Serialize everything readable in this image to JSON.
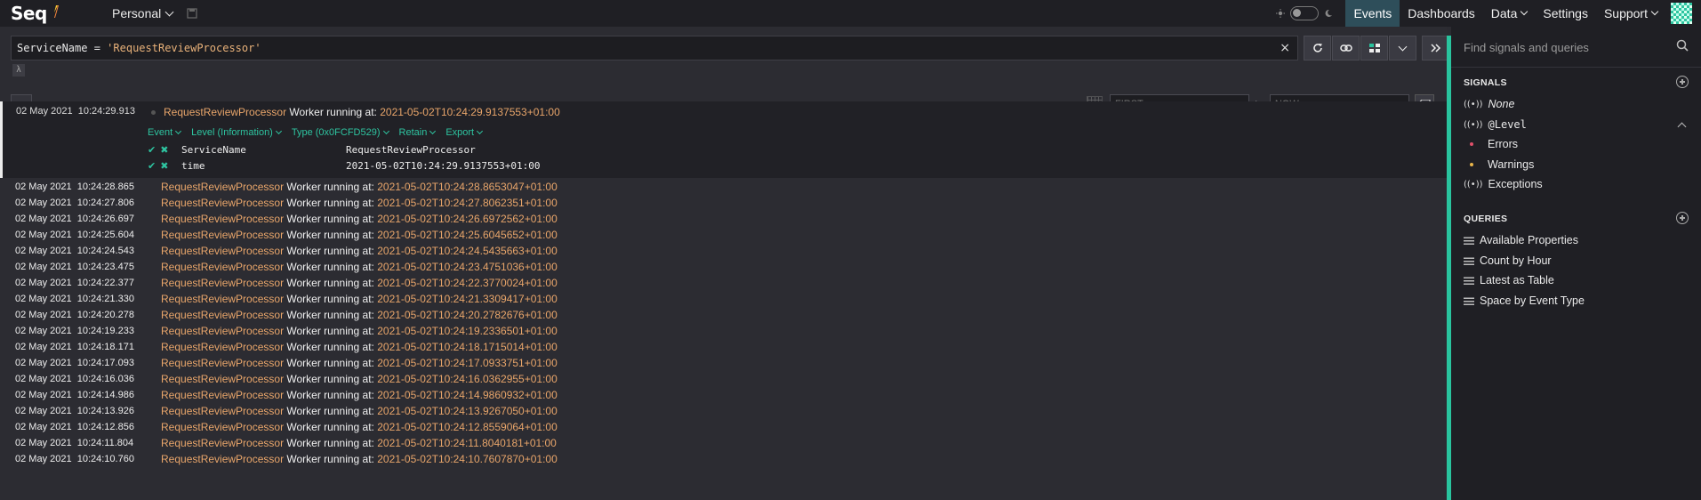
{
  "app": {
    "logo": "Seq",
    "workspace": "Personal"
  },
  "nav": {
    "items": [
      {
        "label": "Events",
        "active": true,
        "dropdown": false
      },
      {
        "label": "Dashboards",
        "active": false,
        "dropdown": false
      },
      {
        "label": "Data",
        "active": false,
        "dropdown": true
      },
      {
        "label": "Settings",
        "active": false,
        "dropdown": false
      },
      {
        "label": "Support",
        "active": false,
        "dropdown": true
      }
    ]
  },
  "query": {
    "field": "ServiceName",
    "op": " = ",
    "value": "'RequestReviewProcessor'",
    "lambda": "λ"
  },
  "range": {
    "from_placeholder": "FIRST",
    "to_label": "to",
    "to_placeholder": "NOW"
  },
  "expanded_event": {
    "timestamp": "02 May 2021  10:24:29.913",
    "service": "RequestReviewProcessor",
    "text": " Worker running at: ",
    "value": "2021-05-02T10:24:29.9137553+01:00",
    "actions": [
      "Event",
      "Level (Information)",
      "Type (0x0FCFD529)",
      "Retain",
      "Export"
    ],
    "properties": [
      {
        "name": "ServiceName",
        "value": "RequestReviewProcessor"
      },
      {
        "name": "time",
        "value": "2021-05-02T10:24:29.9137553+01:00"
      }
    ]
  },
  "events": [
    {
      "timestamp": "02 May 2021  10:24:28.865",
      "service": "RequestReviewProcessor",
      "text": " Worker running at: ",
      "value": "2021-05-02T10:24:28.8653047+01:00"
    },
    {
      "timestamp": "02 May 2021  10:24:27.806",
      "service": "RequestReviewProcessor",
      "text": " Worker running at: ",
      "value": "2021-05-02T10:24:27.8062351+01:00"
    },
    {
      "timestamp": "02 May 2021  10:24:26.697",
      "service": "RequestReviewProcessor",
      "text": " Worker running at: ",
      "value": "2021-05-02T10:24:26.6972562+01:00"
    },
    {
      "timestamp": "02 May 2021  10:24:25.604",
      "service": "RequestReviewProcessor",
      "text": " Worker running at: ",
      "value": "2021-05-02T10:24:25.6045652+01:00"
    },
    {
      "timestamp": "02 May 2021  10:24:24.543",
      "service": "RequestReviewProcessor",
      "text": " Worker running at: ",
      "value": "2021-05-02T10:24:24.5435663+01:00"
    },
    {
      "timestamp": "02 May 2021  10:24:23.475",
      "service": "RequestReviewProcessor",
      "text": " Worker running at: ",
      "value": "2021-05-02T10:24:23.4751036+01:00"
    },
    {
      "timestamp": "02 May 2021  10:24:22.377",
      "service": "RequestReviewProcessor",
      "text": " Worker running at: ",
      "value": "2021-05-02T10:24:22.3770024+01:00"
    },
    {
      "timestamp": "02 May 2021  10:24:21.330",
      "service": "RequestReviewProcessor",
      "text": " Worker running at: ",
      "value": "2021-05-02T10:24:21.3309417+01:00"
    },
    {
      "timestamp": "02 May 2021  10:24:20.278",
      "service": "RequestReviewProcessor",
      "text": " Worker running at: ",
      "value": "2021-05-02T10:24:20.2782676+01:00"
    },
    {
      "timestamp": "02 May 2021  10:24:19.233",
      "service": "RequestReviewProcessor",
      "text": " Worker running at: ",
      "value": "2021-05-02T10:24:19.2336501+01:00"
    },
    {
      "timestamp": "02 May 2021  10:24:18.171",
      "service": "RequestReviewProcessor",
      "text": " Worker running at: ",
      "value": "2021-05-02T10:24:18.1715014+01:00"
    },
    {
      "timestamp": "02 May 2021  10:24:17.093",
      "service": "RequestReviewProcessor",
      "text": " Worker running at: ",
      "value": "2021-05-02T10:24:17.0933751+01:00"
    },
    {
      "timestamp": "02 May 2021  10:24:16.036",
      "service": "RequestReviewProcessor",
      "text": " Worker running at: ",
      "value": "2021-05-02T10:24:16.0362955+01:00"
    },
    {
      "timestamp": "02 May 2021  10:24:14.986",
      "service": "RequestReviewProcessor",
      "text": " Worker running at: ",
      "value": "2021-05-02T10:24:14.9860932+01:00"
    },
    {
      "timestamp": "02 May 2021  10:24:13.926",
      "service": "RequestReviewProcessor",
      "text": " Worker running at: ",
      "value": "2021-05-02T10:24:13.9267050+01:00"
    },
    {
      "timestamp": "02 May 2021  10:24:12.856",
      "service": "RequestReviewProcessor",
      "text": " Worker running at: ",
      "value": "2021-05-02T10:24:12.8559064+01:00"
    },
    {
      "timestamp": "02 May 2021  10:24:11.804",
      "service": "RequestReviewProcessor",
      "text": " Worker running at: ",
      "value": "2021-05-02T10:24:11.8040181+01:00"
    },
    {
      "timestamp": "02 May 2021  10:24:10.760",
      "service": "RequestReviewProcessor",
      "text": " Worker running at: ",
      "value": "2021-05-02T10:24:10.7607870+01:00"
    }
  ],
  "sidebar": {
    "search_placeholder": "Find signals and queries",
    "signals_title": "SIGNALS",
    "signals": [
      {
        "label": "None",
        "italic": true
      },
      {
        "label": "@Level",
        "mono": true
      }
    ],
    "level_children": [
      {
        "label": "Errors",
        "color": "#e0506a"
      },
      {
        "label": "Warnings",
        "color": "#e8b54a"
      }
    ],
    "exceptions": "Exceptions",
    "queries_title": "QUERIES",
    "queries": [
      "Available Properties",
      "Count by Hour",
      "Latest as Table",
      "Space by Event Type"
    ]
  },
  "colors": {
    "accent": "#29c49e",
    "service": "#e8a56a",
    "active_nav": "#2e4e5a"
  }
}
